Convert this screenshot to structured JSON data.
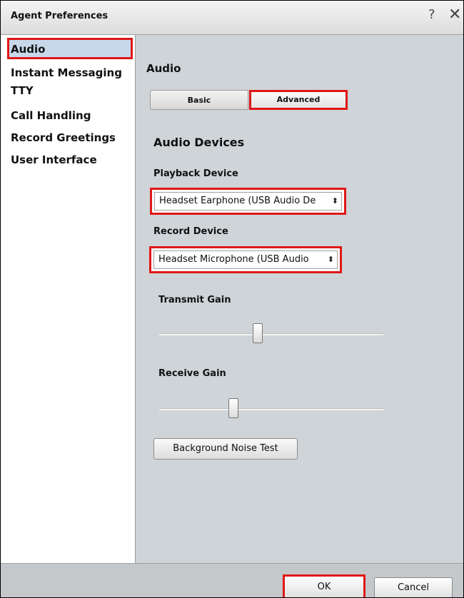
{
  "window": {
    "title": "Agent Preferences",
    "help_label": "?",
    "close_label": "✕"
  },
  "sidebar": {
    "items": [
      {
        "label": "Audio",
        "selected": true
      },
      {
        "label": "Instant Messaging"
      },
      {
        "label": "TTY"
      },
      {
        "label": "Call Handling"
      },
      {
        "label": "Record Greetings"
      },
      {
        "label": "User Interface"
      }
    ]
  },
  "main": {
    "title": "Audio",
    "tabs": [
      {
        "label": "Basic"
      },
      {
        "label": "Advanced",
        "active": true
      }
    ],
    "heading": "Audio Devices",
    "playback": {
      "label": "Playback Device",
      "value": "Headset Earphone (USB Audio De"
    },
    "record": {
      "label": "Record Device",
      "value": "Headset Microphone (USB Audio"
    },
    "select_arrow": "⬍",
    "transmit_gain": {
      "label": "Transmit Gain",
      "level": 0.44
    },
    "receive_gain": {
      "label": "Receive Gain",
      "level": 0.33
    },
    "noise_test_label": "Background Noise Test"
  },
  "footer": {
    "ok_label": "OK",
    "cancel_label": "Cancel"
  },
  "colors": {
    "highlight": "#e01717",
    "selection": "#c7d8ea",
    "panel": "#cfd4d8"
  }
}
